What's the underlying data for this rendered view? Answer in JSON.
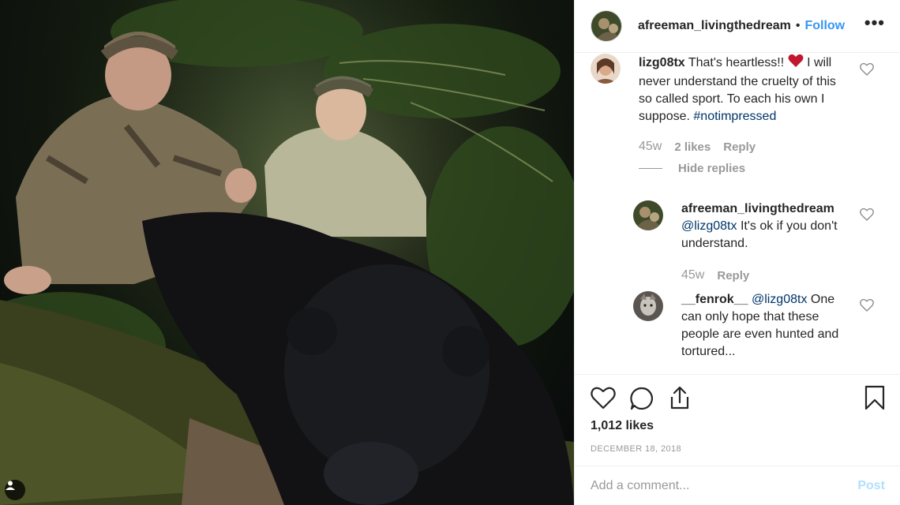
{
  "post": {
    "username": "afreeman_livingthedream",
    "separator": "•",
    "follow_label": "Follow",
    "more_label": "•••",
    "likes": "1,012 likes",
    "date": "DECEMBER 18, 2018",
    "comment_placeholder": "Add a comment...",
    "post_label": "Post"
  },
  "comments": [
    {
      "username": "lizg08tx",
      "text_a": " That's heartless!! ",
      "text_b": " I will never understand the cruelty of this so called sport. To each his own I suppose. ",
      "hashtag": "#notimpressed",
      "time": "45w",
      "likes": "2 likes",
      "reply_label": "Reply",
      "hide_replies": "Hide replies"
    },
    {
      "username": "afreeman_livingthedream",
      "mention": "@lizg08tx",
      "text": " It's ok if you don't understand.",
      "time": "45w",
      "reply_label": "Reply"
    },
    {
      "username": "__fenrok__",
      "mention": "@lizg08tx",
      "text": " One can only hope that these people are even hunted and tortured..."
    }
  ],
  "icons": {
    "like": "heart-icon",
    "comment": "comment-icon",
    "share": "share-icon",
    "save": "bookmark-icon",
    "more": "more-icon",
    "user_tag": "user-tag-icon"
  },
  "colors": {
    "link_blue": "#3897f0",
    "hashtag_blue": "#003569",
    "muted": "#999999",
    "text": "#262626",
    "heart_red": "#c0182e"
  }
}
